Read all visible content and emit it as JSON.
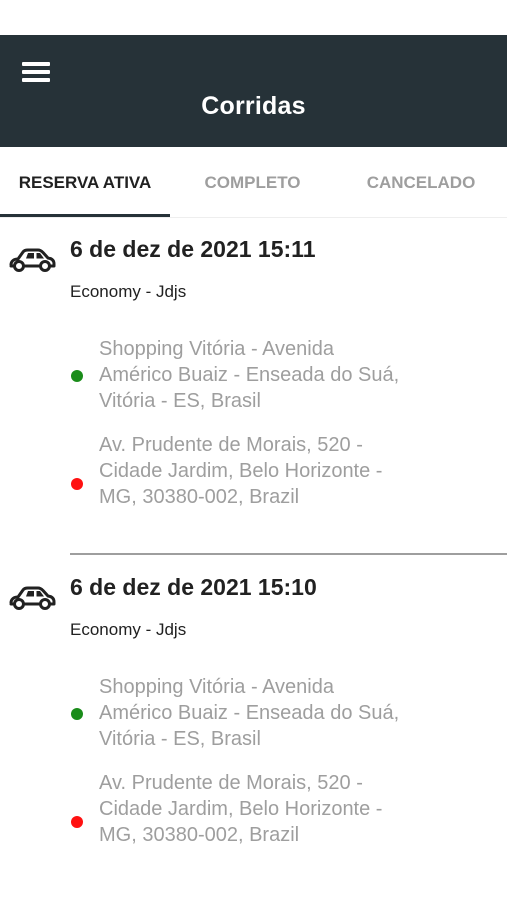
{
  "app_bar": {
    "title": "Corridas",
    "menu_icon": "hamburger-menu-icon",
    "background": "#263238"
  },
  "tabs": [
    {
      "label": "RESERVA ATIVA",
      "active": true
    },
    {
      "label": "COMPLETO",
      "active": false
    },
    {
      "label": "CANCELADO",
      "active": false
    }
  ],
  "trips": [
    {
      "icon": "car-icon",
      "date": "6 de dez de 2021 15:11",
      "vehicle": "Economy - Jdjs",
      "pickup": "Shopping Vitória - Avenida Américo Buaiz - Enseada do Suá, Vitória - ES, Brasil",
      "dropoff": "Av. Prudente de Morais, 520 - Cidade Jardim, Belo Horizonte - MG, 30380-002, Brazil"
    },
    {
      "icon": "car-icon",
      "date": "6 de dez de 2021 15:10",
      "vehicle": "Economy - Jdjs",
      "pickup": "Shopping Vitória - Avenida Américo Buaiz - Enseada do Suá, Vitória - ES, Brasil",
      "dropoff": "Av. Prudente de Morais, 520 - Cidade Jardim, Belo Horizonte - MG, 30380-002, Brazil"
    }
  ],
  "colors": {
    "pickup_dot": "#1a8c1a",
    "dropoff_dot": "#ff1111",
    "address_text": "#9e9e9e"
  }
}
